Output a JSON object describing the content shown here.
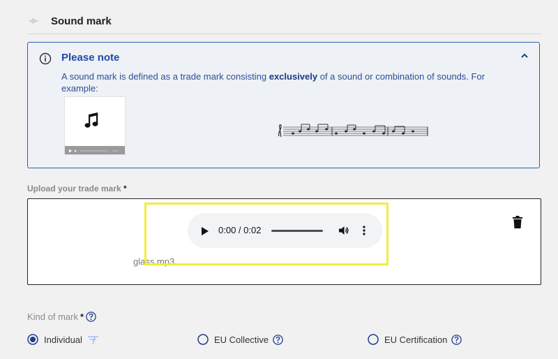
{
  "section": {
    "title": "Sound mark"
  },
  "note": {
    "title": "Please note",
    "text_before": "A sound mark is defined as a trade mark consisting ",
    "text_bold": "exclusively",
    "text_after": " of a sound or combination of sounds. For example:"
  },
  "upload": {
    "label": "Upload your trade mark",
    "required_mark": "*",
    "audio_time": "0:00 / 0:02",
    "filename": "glass.mp3"
  },
  "kind_of_mark": {
    "label": "Kind of mark",
    "required_mark": "*",
    "options": [
      {
        "label": "Individual",
        "selected": true
      },
      {
        "label": "EU Collective",
        "selected": false
      },
      {
        "label": "EU Certification",
        "selected": false
      }
    ]
  },
  "colors": {
    "accent": "#2f5bb0",
    "highlight": "#f2ee3a",
    "background": "#f1f1f1"
  }
}
